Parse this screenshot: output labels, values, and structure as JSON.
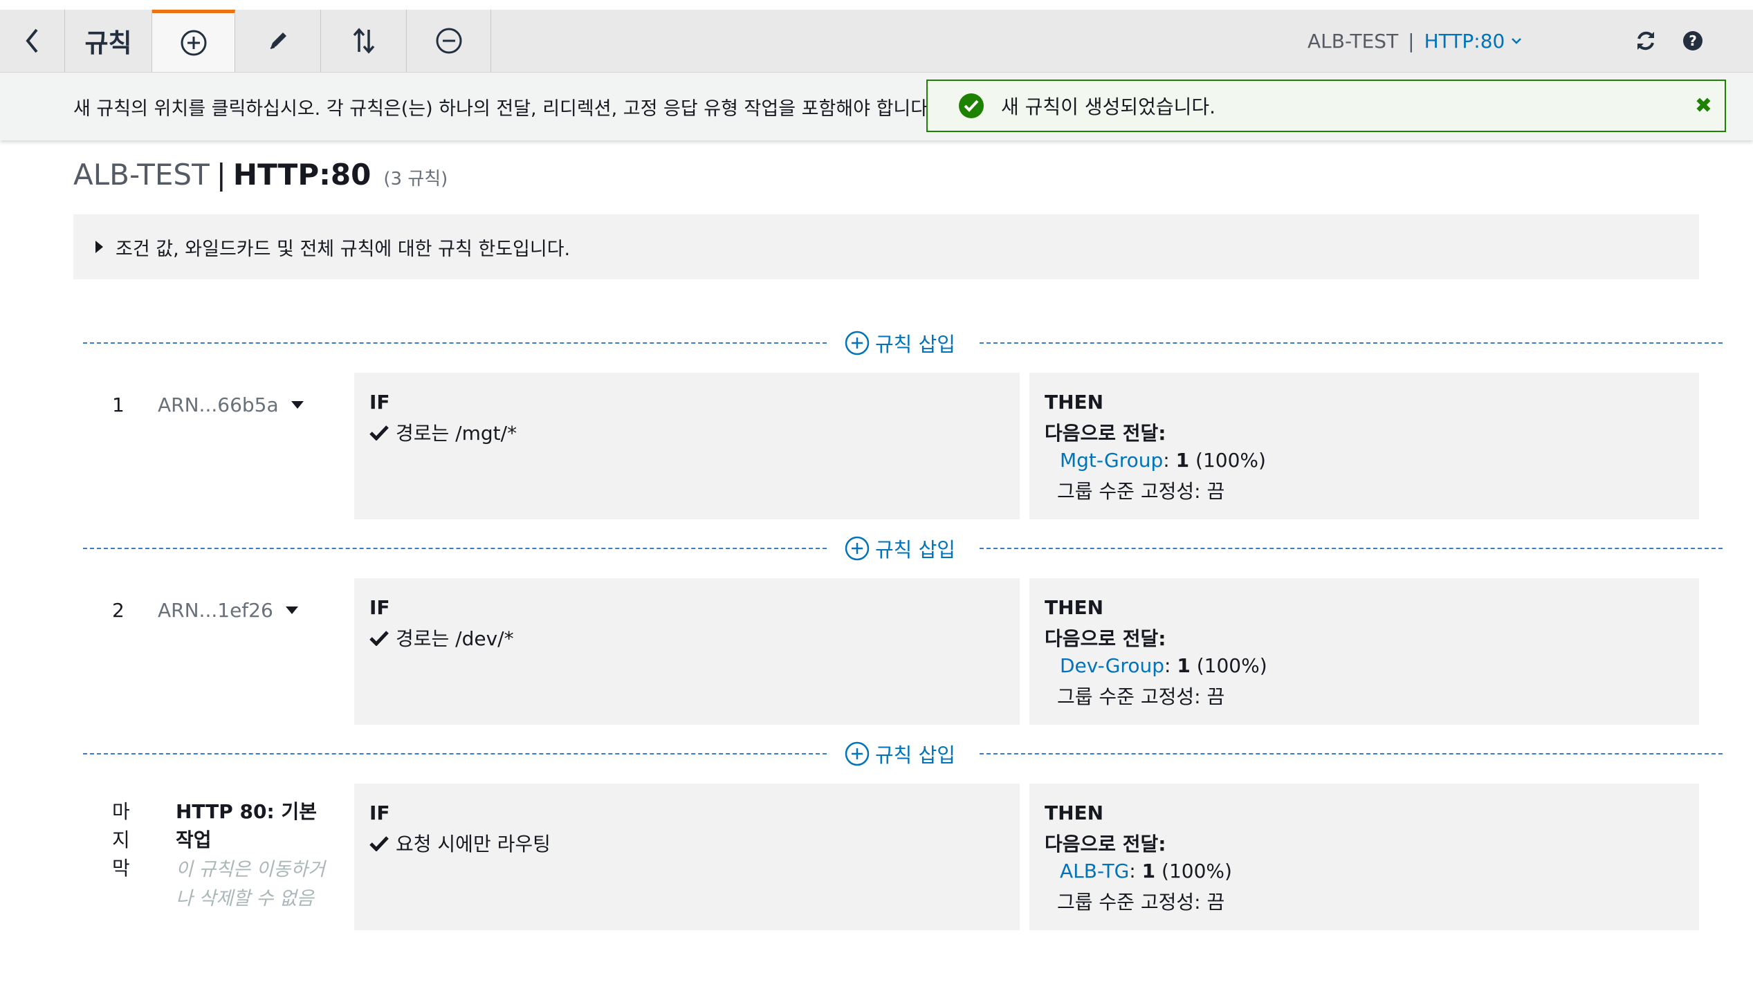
{
  "toolbar": {
    "back_icon": "chevron-left-icon",
    "title": "규칙",
    "add_icon": "plus-circle-icon",
    "edit_icon": "pencil-icon",
    "reorder_icon": "sort-arrows-icon",
    "delete_icon": "minus-circle-icon",
    "lb_name": "ALB-TEST",
    "separator": "|",
    "listener": "HTTP:80",
    "refresh_icon": "refresh-icon",
    "help_icon": "help-icon"
  },
  "message": {
    "instruction": "새 규칙의 위치를 클릭하십시오. 각 규칙은(는) 하나의 전달, 리디렉션, 고정 응답 유형 작업을 포함해야 합니다.",
    "alert_text": "새 규칙이 생성되었습니다.",
    "alert_close": "✖"
  },
  "heading": {
    "lb_name": "ALB-TEST",
    "separator": "|",
    "listener": "HTTP:80",
    "rule_count": "(3 규칙)"
  },
  "info_panel": {
    "text": "조건 값, 와일드카드 및 전체 규칙에 대한 규칙 한도입니다."
  },
  "insert_label": "규칙 삽입",
  "labels": {
    "if": "IF",
    "then": "THEN",
    "forward_to": "다음으로 전달:",
    "stickiness": "그룹 수준 고정성: 끔"
  },
  "rules": [
    {
      "number": "1",
      "arn": "ARN...66b5a",
      "condition": "경로는 /mgt/*",
      "target_group": "Mgt-Group",
      "weight_sep": ":",
      "weight": "1",
      "percent": "(100%)"
    },
    {
      "number": "2",
      "arn": "ARN...1ef26",
      "condition": "경로는 /dev/*",
      "target_group": "Dev-Group",
      "weight_sep": ":",
      "weight": "1",
      "percent": "(100%)"
    }
  ],
  "default_rule": {
    "label_chars": [
      "마",
      "지",
      "막"
    ],
    "title": "HTTP 80: 기본 작업",
    "note": "이 규칙은 이동하거나 삭제할 수 없음",
    "condition": "요청 시에만 라우팅",
    "target_group": "ALB-TG",
    "weight_sep": ":",
    "weight": "1",
    "percent": "(100%)"
  },
  "colors": {
    "accent_orange": "#ec7211",
    "link_blue": "#0073bb",
    "success_green": "#1d8102",
    "dash_blue": "#3a7bc8"
  }
}
